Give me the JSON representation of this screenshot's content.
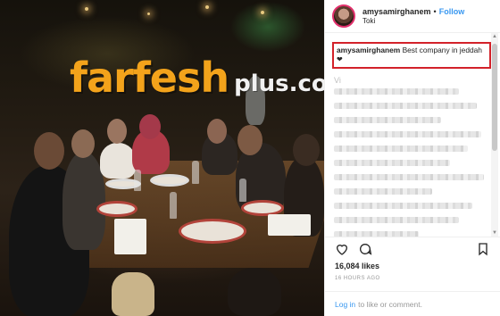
{
  "watermark": {
    "main": "farfesh",
    "sub": "plus.com"
  },
  "post": {
    "username": "amysamirghanem",
    "separator": "•",
    "follow_label": "Follow",
    "location": "Toki"
  },
  "caption": {
    "username": "amysamirghanem",
    "text": "Best company in jeddah",
    "emoji": "❤"
  },
  "comments": {
    "more_text": "Vi"
  },
  "actions": {
    "like_icon": "heart-icon",
    "comment_icon": "comment-icon",
    "save_icon": "bookmark-icon"
  },
  "likes": {
    "count": "16,084",
    "label": "likes"
  },
  "timestamp": "16 HOURS AGO",
  "login_bar": {
    "link": "Log in",
    "text": "to like or comment."
  },
  "colors": {
    "accent": "#3897f0",
    "highlight_box": "#d3222a",
    "watermark": "#f3a31b"
  }
}
